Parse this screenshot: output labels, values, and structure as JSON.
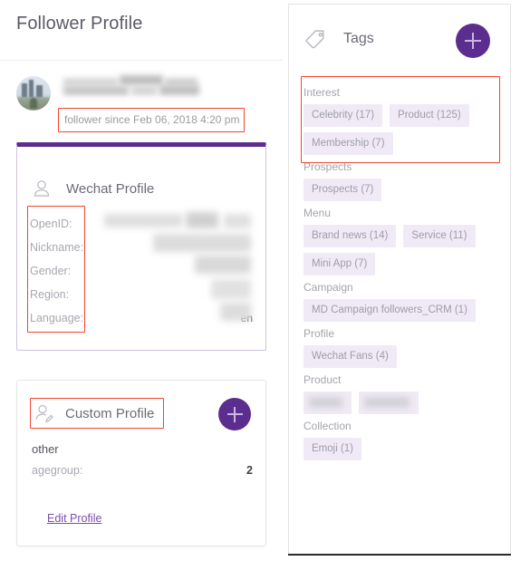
{
  "page": {
    "title": "Follower Profile"
  },
  "follower": {
    "since_text": "follower since Feb 06, 2018 4:20 pm",
    "name_redacted": true,
    "avatar_icon": "user-avatar-photo"
  },
  "wechat_card": {
    "title": "Wechat Profile",
    "icon": "user-icon",
    "fields": [
      {
        "label": "OpenID:",
        "value": "",
        "redacted": true
      },
      {
        "label": "Nickname:",
        "value": "",
        "redacted": true
      },
      {
        "label": "Gender:",
        "value": "",
        "redacted": true
      },
      {
        "label": "Region:",
        "value": "",
        "redacted": true
      },
      {
        "label": "Language:",
        "value": "en",
        "redacted": false
      }
    ]
  },
  "custom_card": {
    "title": "Custom Profile",
    "icon": "user-edit-icon",
    "add_button_icon": "plus-icon",
    "section_label": "other",
    "rows": [
      {
        "label": "agegroup:",
        "value": "2"
      }
    ],
    "edit_link": "Edit Profile"
  },
  "tags_panel": {
    "title": "Tags",
    "icon": "tag-icon",
    "add_button_icon": "plus-icon",
    "groups": [
      {
        "label": "Interest",
        "highlighted": true,
        "chips": [
          {
            "text": "Celebrity (17)",
            "redacted": false
          },
          {
            "text": "Product (125)",
            "redacted": false
          },
          {
            "text": "Membership (7)",
            "redacted": false
          }
        ]
      },
      {
        "label": "Prospects",
        "highlighted": false,
        "chips": [
          {
            "text": "Prospects (7)",
            "redacted": false
          }
        ]
      },
      {
        "label": "Menu",
        "highlighted": false,
        "chips": [
          {
            "text": "Brand news (14)",
            "redacted": false
          },
          {
            "text": "Service (11)",
            "redacted": false
          },
          {
            "text": "Mini App (7)",
            "redacted": false
          }
        ]
      },
      {
        "label": "Campaign",
        "highlighted": false,
        "chips": [
          {
            "text": "MD Campaign followers_CRM (1)",
            "redacted": false
          }
        ]
      },
      {
        "label": "Profile",
        "highlighted": false,
        "chips": [
          {
            "text": "Wechat Fans (4)",
            "redacted": false
          }
        ]
      },
      {
        "label": "Product",
        "highlighted": false,
        "chips": [
          {
            "text": "           ",
            "redacted": true
          },
          {
            "text": "               ",
            "redacted": true
          }
        ]
      },
      {
        "label": "Collection",
        "highlighted": false,
        "chips": [
          {
            "text": "Emoji (1)",
            "redacted": false
          }
        ]
      }
    ]
  },
  "colors": {
    "brand_purple": "#5b2d8e",
    "link_purple": "#7b4fae",
    "chip_bg": "#f0eaf6",
    "highlight_red": "#f4442e",
    "muted_text": "#a4a4ac"
  }
}
